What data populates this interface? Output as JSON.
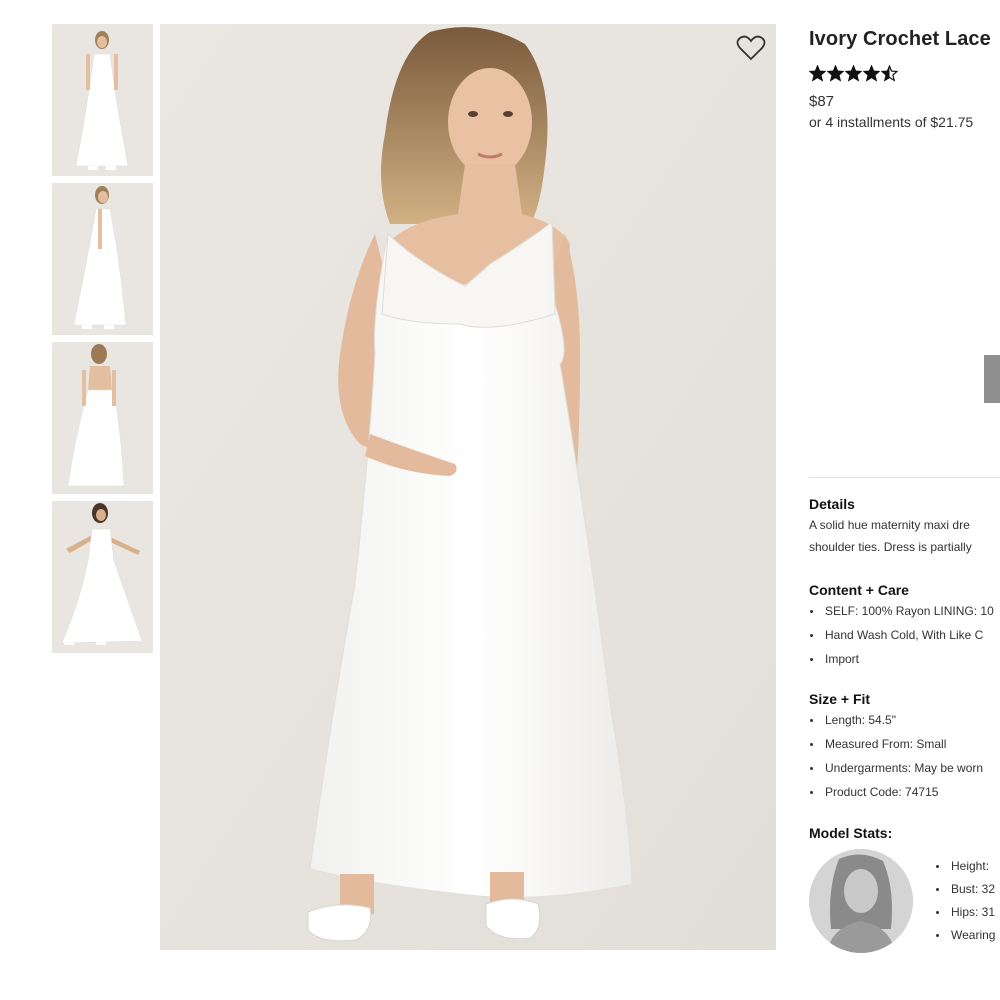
{
  "product": {
    "title": "Ivory Crochet Lace",
    "rating": 4.5,
    "price": "$87",
    "installments": "or 4 installments of $21.75"
  },
  "gallery": {
    "thumbnails": [
      {
        "view": "front"
      },
      {
        "view": "side"
      },
      {
        "view": "back"
      },
      {
        "view": "front-arms-out"
      }
    ],
    "favorite_icon": "heart-outline-icon"
  },
  "details": {
    "title": "Details",
    "lines": [
      "A solid hue maternity maxi dre",
      "shoulder ties. Dress is partially"
    ]
  },
  "content_care": {
    "title": "Content + Care",
    "items": [
      "SELF: 100% Rayon LINING: 10",
      "Hand Wash Cold, With Like C",
      "Import"
    ]
  },
  "size_fit": {
    "title": "Size + Fit",
    "items": [
      "Length: 54.5\"",
      "Measured From: Small",
      "Undergarments: May be worn",
      "Product Code: 74715"
    ]
  },
  "model_stats": {
    "title": "Model Stats:",
    "items": [
      "Height:",
      "Bust: 32",
      "Hips: 31",
      "Wearing"
    ]
  },
  "colors": {
    "button_gray": "#8f8f8f",
    "photo_bg": "#e8e5e0",
    "dress": "#fbfbf9"
  }
}
